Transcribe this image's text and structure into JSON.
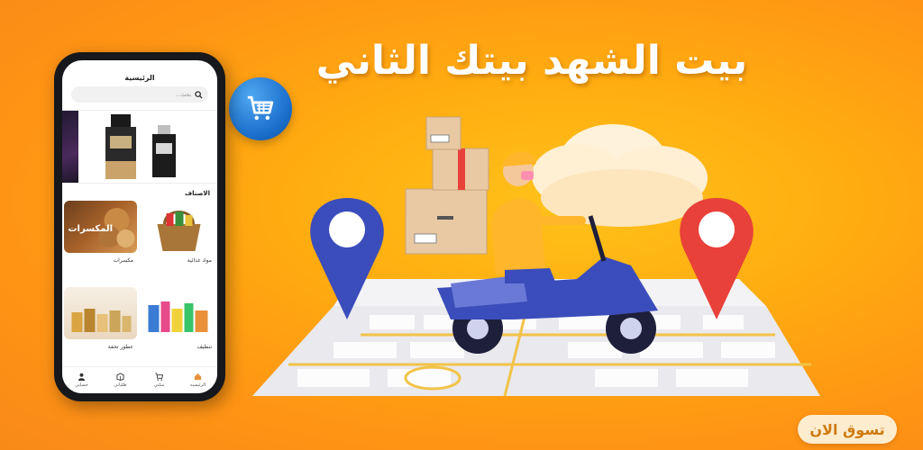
{
  "banner": {
    "headline": "بيت الشهد بيتك الثاني",
    "cta_label": "تسوق الان"
  },
  "app": {
    "title": "الرئيسية",
    "search_placeholder": "بحث...",
    "categories_heading": "الاصناف",
    "categories": [
      {
        "label": "مكسرات",
        "image_text": "المكسرات"
      },
      {
        "label": "مواد غذائية",
        "image_text": ""
      },
      {
        "label": "عطور تحفة",
        "image_text": ""
      },
      {
        "label": "تنظيف",
        "image_text": ""
      }
    ],
    "nav": [
      {
        "label": "الرئيسية",
        "icon": "home-icon"
      },
      {
        "label": "سلتي",
        "icon": "cart-icon"
      },
      {
        "label": "طلباتي",
        "icon": "box-icon"
      },
      {
        "label": "حسابي",
        "icon": "user-icon"
      }
    ]
  },
  "colors": {
    "background": "#ffa812",
    "accent_blue": "#3b4dbb",
    "pin_red": "#e8413a",
    "cart_blue": "#1a6fcc",
    "cta_bg": "#fdeccd",
    "cta_text": "#d07a10"
  }
}
